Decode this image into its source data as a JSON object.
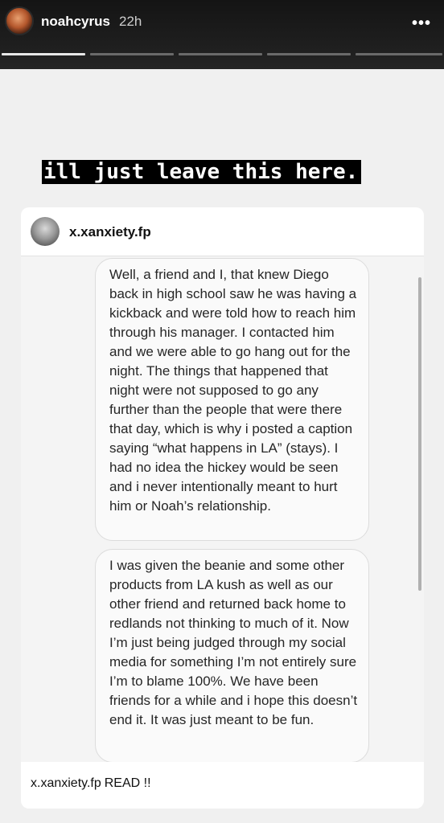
{
  "header": {
    "username": "noahcyrus",
    "time_ago": "22h",
    "more_icon": "more-dots-icon",
    "progress_segments": [
      {
        "state": "viewed"
      },
      {
        "state": "upcoming"
      },
      {
        "state": "upcoming"
      },
      {
        "state": "upcoming"
      },
      {
        "state": "upcoming"
      }
    ]
  },
  "story": {
    "caption": "ill just leave this here.",
    "post": {
      "username": "x.xanxiety.fp",
      "messages": [
        "Well, a friend and I, that knew Diego back in high school saw he was having a kickback and were told how to reach him through his manager. I contacted him and we were able to go hang out for the night. The things that happened that night were not supposed to go any further than the people that were there that day, which is why i posted a caption saying “what happens in LA” (stays). I had no idea the hickey would be seen and i never intentionally meant to hurt him or Noah’s relationship.",
        "I was given the beanie and some other products from LA kush as well as our other friend and returned back home to redlands not thinking to much of it. Now I’m just being judged through my social media for something I’m not entirely sure I’m to blame 100%. We have been friends for a while and i hope this doesn’t end it. It was just meant to be fun."
      ],
      "caption_user": "x.xanxiety.fp",
      "caption_text": "READ !!"
    }
  },
  "colors": {
    "background": "#1a1a1a",
    "story_background": "#f0f0f0",
    "caption_background": "#000000",
    "bubble_border": "#dcdcdc"
  }
}
